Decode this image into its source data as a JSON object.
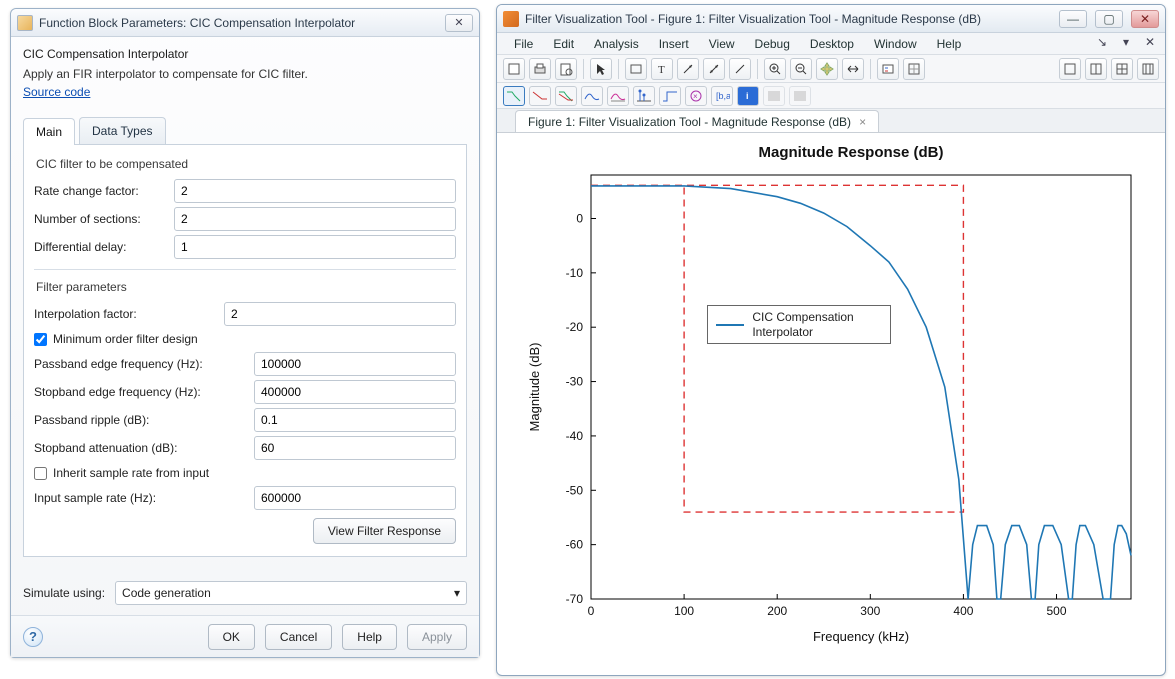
{
  "dialog": {
    "title": "Function Block Parameters: CIC Compensation Interpolator",
    "header_title": "CIC Compensation Interpolator",
    "header_desc": "Apply an FIR interpolator to compensate for CIC filter.",
    "source_link": "Source code",
    "tabs": {
      "main": "Main",
      "types": "Data Types"
    },
    "group_cic": "CIC filter to be compensated",
    "group_filter": "Filter parameters",
    "labels": {
      "rate": "Rate change factor:",
      "sections": "Number of sections:",
      "delay": "Differential delay:",
      "interp": "Interpolation factor:",
      "min_order": "Minimum order filter design",
      "pass_edge": "Passband edge frequency (Hz):",
      "stop_edge": "Stopband edge frequency (Hz):",
      "pass_rip": "Passband ripple (dB):",
      "stop_att": "Stopband attenuation (dB):",
      "inherit": "Inherit sample rate from input",
      "samp_rate": "Input sample rate (Hz):",
      "view_btn": "View Filter Response",
      "sim_using": "Simulate using:",
      "sim_value": "Code generation",
      "ok": "OK",
      "cancel": "Cancel",
      "help": "Help",
      "apply": "Apply"
    },
    "values": {
      "rate": "2",
      "sections": "2",
      "delay": "1",
      "interp": "2",
      "pass_edge": "100000",
      "stop_edge": "400000",
      "pass_rip": "0.1",
      "stop_att": "60",
      "samp_rate": "600000"
    }
  },
  "figure": {
    "title": "Filter Visualization Tool - Figure 1: Filter Visualization Tool - Magnitude Response (dB)",
    "menu": [
      "File",
      "Edit",
      "Analysis",
      "Insert",
      "View",
      "Debug",
      "Desktop",
      "Window",
      "Help"
    ],
    "doc_tab": "Figure 1: Filter Visualization Tool - Magnitude Response (dB)",
    "plot_title": "Magnitude Response (dB)",
    "ylabel": "Magnitude (dB)",
    "xlabel": "Frequency (kHz)",
    "legend": "CIC Compensation Interpolator"
  },
  "chart_data": {
    "type": "line",
    "title": "Magnitude Response (dB)",
    "xlabel": "Frequency (kHz)",
    "ylabel": "Magnitude (dB)",
    "xlim": [
      0,
      580
    ],
    "ylim": [
      -70,
      8
    ],
    "xticks": [
      0,
      100,
      200,
      300,
      400,
      500
    ],
    "yticks": [
      -70,
      -60,
      -50,
      -40,
      -30,
      -20,
      -10,
      0
    ],
    "series": [
      {
        "name": "CIC Compensation Interpolator",
        "color": "#1f77b4",
        "x": [
          0,
          50,
          100,
          150,
          200,
          225,
          250,
          275,
          300,
          320,
          340,
          360,
          380,
          395,
          405,
          410,
          415,
          425,
          432,
          436,
          440,
          445,
          452,
          460,
          468,
          473,
          477,
          481,
          487,
          496,
          505,
          513,
          517,
          521,
          525,
          531,
          540,
          550,
          558,
          562,
          566,
          570,
          575,
          580
        ],
        "y": [
          6,
          6,
          6,
          5.5,
          4,
          2.8,
          1,
          -1.5,
          -5,
          -8,
          -13,
          -20,
          -31,
          -48,
          -70,
          -60,
          -56.5,
          -56.5,
          -60,
          -70,
          -70,
          -60,
          -56.5,
          -56.5,
          -60,
          -70,
          -70,
          -60,
          -56.5,
          -56.5,
          -60,
          -70,
          -70,
          -60,
          -56.5,
          -56.5,
          -60,
          -70,
          -70,
          -60,
          -56.5,
          -56.5,
          -58,
          -62
        ]
      }
    ],
    "mask": {
      "pass_x": 100,
      "stop_x": 400,
      "pass_top": 6.1,
      "pass_bot": 5.9,
      "mask_level": -54
    }
  }
}
